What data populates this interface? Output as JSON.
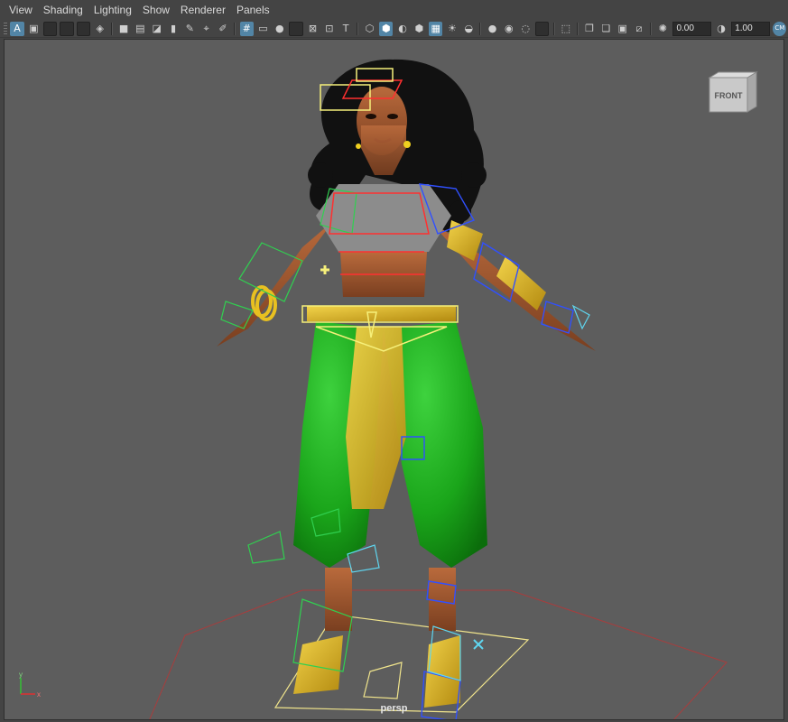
{
  "menu": [
    "View",
    "Shading",
    "Lighting",
    "Show",
    "Renderer",
    "Panels"
  ],
  "toolbar": {
    "exposure_value": "0.00",
    "gamma_value": "1.00",
    "icons": [
      "select-camera",
      "camera-attributes",
      "bookmark",
      "image-plane",
      "2d-pan-zoom",
      "grease-pencil",
      "grid",
      "film-gate",
      "resolution-gate",
      "gate-mask",
      "field-chart",
      "safe-action",
      "wireframe",
      "smooth-shade",
      "wireframe-on-shaded",
      "textured",
      "use-all-lights",
      "shadows",
      "screen-space-ao",
      "motion-blur",
      "anti-aliasing",
      "depth-of-field",
      "isolate-select",
      "xray",
      "xray-active-components",
      "xray-joints",
      "exposure",
      "gamma",
      "color-management"
    ]
  },
  "viewport": {
    "camera_label": "persp",
    "viewcube_label": "FRONT",
    "axis_x": "x",
    "axis_y": "y",
    "background_color": "#5d5d5d",
    "ground_grid_color": "#b33a3a"
  }
}
